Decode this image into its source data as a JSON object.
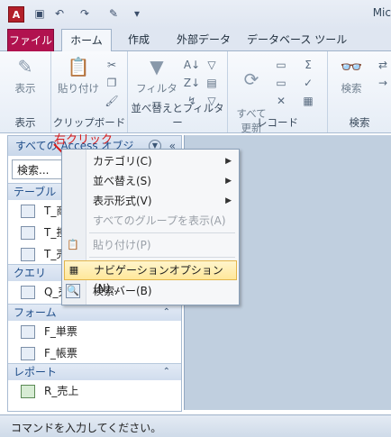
{
  "titlebar": {
    "app_icon": "A",
    "title": "Mic"
  },
  "tabs": {
    "file": "ファイル",
    "home": "ホーム",
    "create": "作成",
    "external": "外部データ",
    "dbtools": "データベース ツール"
  },
  "ribbon": {
    "groups": {
      "view": "表示",
      "clipboard": "クリップボード",
      "sort_filter": "並べ替えとフィルター",
      "records": "レコード",
      "find": "検索"
    },
    "buttons": {
      "view": "表示",
      "paste": "貼り付け",
      "filter": "フィルター",
      "refresh": "すべて\n更新",
      "find": "検索"
    }
  },
  "nav": {
    "header": "すべての Access オブジ",
    "search_value": "検索...",
    "sections": [
      {
        "label": "テーブル",
        "items": [
          "T_商",
          "T_担",
          "T_売"
        ]
      },
      {
        "label": "クエリ",
        "items": [
          "Q_売"
        ]
      },
      {
        "label": "フォーム",
        "items": [
          "F_単票",
          "F_帳票"
        ]
      },
      {
        "label": "レポート",
        "items": [
          "R_売上"
        ]
      }
    ]
  },
  "annotation": "右クリック",
  "context_menu": [
    {
      "label": "カテゴリ(C)",
      "submenu": true,
      "disabled": false
    },
    {
      "label": "並べ替え(S)",
      "submenu": true,
      "disabled": false
    },
    {
      "label": "表示形式(V)",
      "submenu": true,
      "disabled": false
    },
    {
      "label": "すべてのグループを表示(A)",
      "submenu": false,
      "disabled": true
    },
    {
      "label": "貼り付け(P)",
      "submenu": false,
      "disabled": true
    },
    {
      "label": "ナビゲーションオプション(N)...",
      "submenu": false,
      "disabled": false,
      "highlighted": true
    },
    {
      "label": "検索バー(B)",
      "submenu": false,
      "disabled": false
    }
  ],
  "statusbar": "コマンドを入力してください。"
}
